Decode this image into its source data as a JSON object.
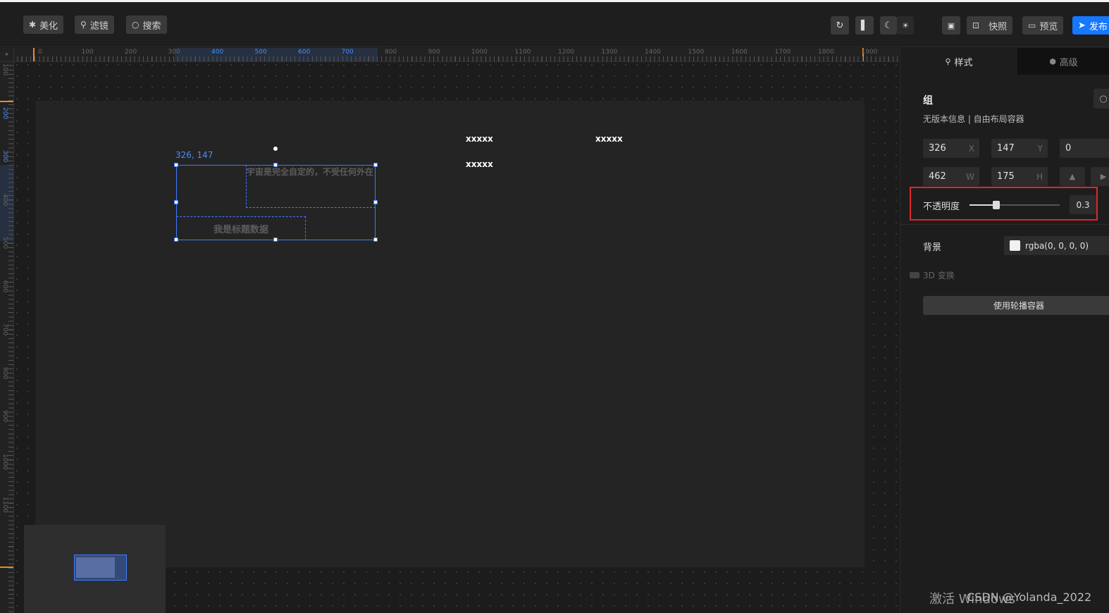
{
  "toolbar": {
    "beautify": "美化",
    "filter": "滤镜",
    "search": "搜索",
    "snapshot": "快照",
    "preview": "预览",
    "publish": "发布"
  },
  "ruler": {
    "top_ticks": [
      "0",
      "100",
      "200",
      "300",
      "400",
      "500",
      "600",
      "700",
      "800",
      "900",
      "1000",
      "1100",
      "1200",
      "1300",
      "1400",
      "1500",
      "1600",
      "1700",
      "1800",
      "1900"
    ],
    "left_ticks": [
      "100",
      "200",
      "300",
      "400",
      "500",
      "600",
      "700",
      "800",
      "900",
      "1000",
      "1100"
    ]
  },
  "canvas": {
    "selection_coords": "326, 147",
    "text_block": "宇宙是完全自定的，不受任何外在",
    "title_text": "我是标题数据",
    "placeholder_1": "xxxxx",
    "placeholder_2": "xxxxx",
    "placeholder_3": "xxxxx"
  },
  "panel": {
    "tab_style": "样式",
    "tab_advanced": "高级",
    "section_title": "组",
    "subtitle": "无版本信息 | 自由布局容器",
    "x_value": "326",
    "x_suffix": "X",
    "y_value": "147",
    "y_suffix": "Y",
    "r_value": "0",
    "w_value": "462",
    "w_suffix": "W",
    "h_value": "175",
    "h_suffix": "H",
    "opacity_label": "不透明度",
    "opacity_value": "0.3",
    "background_label": "背景",
    "background_value": "rgba(0, 0, 0, 0)",
    "transform3d_label": "3D 变换",
    "carousel_button": "使用轮播容器"
  },
  "watermark": {
    "activate": "激活 Windows",
    "csdn": "CSDN @Yolanda_2022"
  },
  "colors": {
    "accent": "#3d7bff",
    "publish": "#1677ff",
    "highlight_box": "#e0262b"
  }
}
